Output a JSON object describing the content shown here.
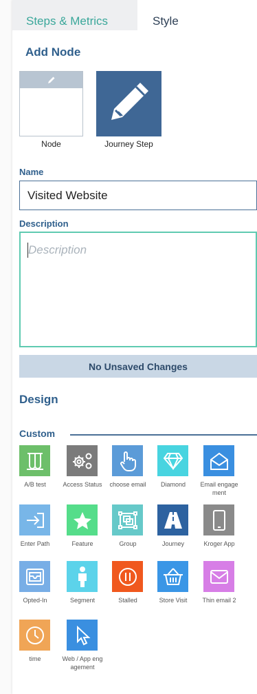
{
  "tabs": {
    "steps_metrics": "Steps & Metrics",
    "style": "Style"
  },
  "add_node": {
    "title": "Add Node",
    "node_label": "Node",
    "journey_step_label": "Journey Step"
  },
  "form": {
    "name_label": "Name",
    "name_value": "Visited Website",
    "description_label": "Description",
    "description_placeholder": "Description",
    "status": "No Unsaved Changes"
  },
  "design": {
    "title": "Design",
    "custom_title": "Custom",
    "tiles": [
      {
        "label": "A/B test",
        "color": "#6dbf6a",
        "icon": "ab-test-icon"
      },
      {
        "label": "Access Status",
        "color": "#7b7b7b",
        "icon": "gears-icon"
      },
      {
        "label": "choose email",
        "color": "#5b9bd8",
        "icon": "hand-pointer-icon"
      },
      {
        "label": "Diamond",
        "color": "#48d4e0",
        "icon": "diamond-icon"
      },
      {
        "label": "Email engagement",
        "color": "#3a8fe0",
        "icon": "envelope-open-icon"
      },
      {
        "label": "Enter Path",
        "color": "#78b6e8",
        "icon": "enter-icon"
      },
      {
        "label": "Feature",
        "color": "#55dd8a",
        "icon": "star-icon"
      },
      {
        "label": "Group",
        "color": "#66c9c9",
        "icon": "group-icon"
      },
      {
        "label": "Journey",
        "color": "#2d62a0",
        "icon": "road-icon"
      },
      {
        "label": "Kroger App",
        "color": "#8a8a8a",
        "icon": "phone-icon"
      },
      {
        "label": "Opted-In",
        "color": "#78aee6",
        "icon": "inbox-icon"
      },
      {
        "label": "Segment",
        "color": "#5cd3ea",
        "icon": "person-icon"
      },
      {
        "label": "Stalled",
        "color": "#f0581e",
        "icon": "pause-icon"
      },
      {
        "label": "Store Visit",
        "color": "#3a96e6",
        "icon": "basket-icon"
      },
      {
        "label": "Thin email 2",
        "color": "#d77ee6",
        "icon": "envelope-icon"
      },
      {
        "label": "time",
        "color": "#f0a556",
        "icon": "clock-icon"
      },
      {
        "label": "Web / App engagement",
        "color": "#3a8fe0",
        "icon": "cursor-icon"
      }
    ]
  }
}
